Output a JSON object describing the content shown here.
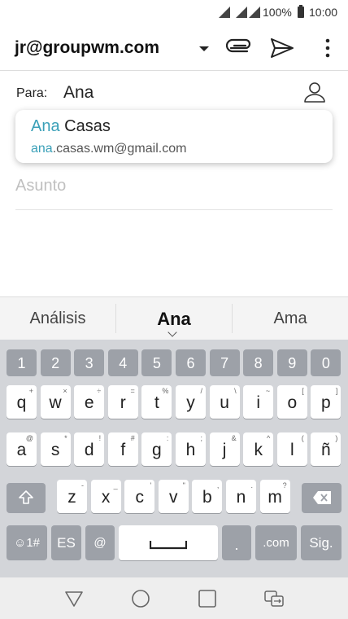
{
  "status": {
    "battery": "100%",
    "time": "10:00"
  },
  "header": {
    "from": "jr@groupwm.com"
  },
  "to": {
    "label": "Para:",
    "value": "Ana"
  },
  "suggestion": {
    "name_match": "Ana",
    "name_rest": " Casas",
    "email_match": "ana",
    "email_rest": ".casas.wm@gmail.com"
  },
  "subject": {
    "placeholder": "Asunto"
  },
  "predictions": [
    "Análisis",
    "Ana",
    "Ama"
  ],
  "keyboard": {
    "numbers": [
      "1",
      "2",
      "3",
      "4",
      "5",
      "6",
      "7",
      "8",
      "9",
      "0"
    ],
    "row1": [
      "q",
      "w",
      "e",
      "r",
      "t",
      "y",
      "u",
      "i",
      "o",
      "p"
    ],
    "row1_alt": [
      "+",
      "×",
      "÷",
      "=",
      "%",
      "/",
      "\\",
      "~",
      "[",
      "]"
    ],
    "row2": [
      "a",
      "s",
      "d",
      "f",
      "g",
      "h",
      "j",
      "k",
      "l",
      "ñ"
    ],
    "row2_alt": [
      "@",
      "*",
      "!",
      "#",
      ":",
      ";",
      "&",
      "^",
      "(",
      ")"
    ],
    "row3": [
      "z",
      "x",
      "c",
      "v",
      "b",
      "n",
      "m"
    ],
    "row3_alt": [
      "-",
      "_",
      "'",
      "\"",
      ",",
      ".",
      "?"
    ],
    "bottom": {
      "symbols": "☺1#",
      "lang": "ES",
      "at": "@",
      "period": ".",
      "dotcom": ".com",
      "next": "Sig."
    }
  },
  "icons": [
    "signal-icon",
    "battery-icon",
    "dropdown-icon",
    "attach-icon",
    "send-icon",
    "more-icon",
    "contact-icon",
    "shift-icon",
    "backspace-icon",
    "space-icon",
    "back-icon",
    "home-icon",
    "recents-icon",
    "switch-app-icon"
  ]
}
